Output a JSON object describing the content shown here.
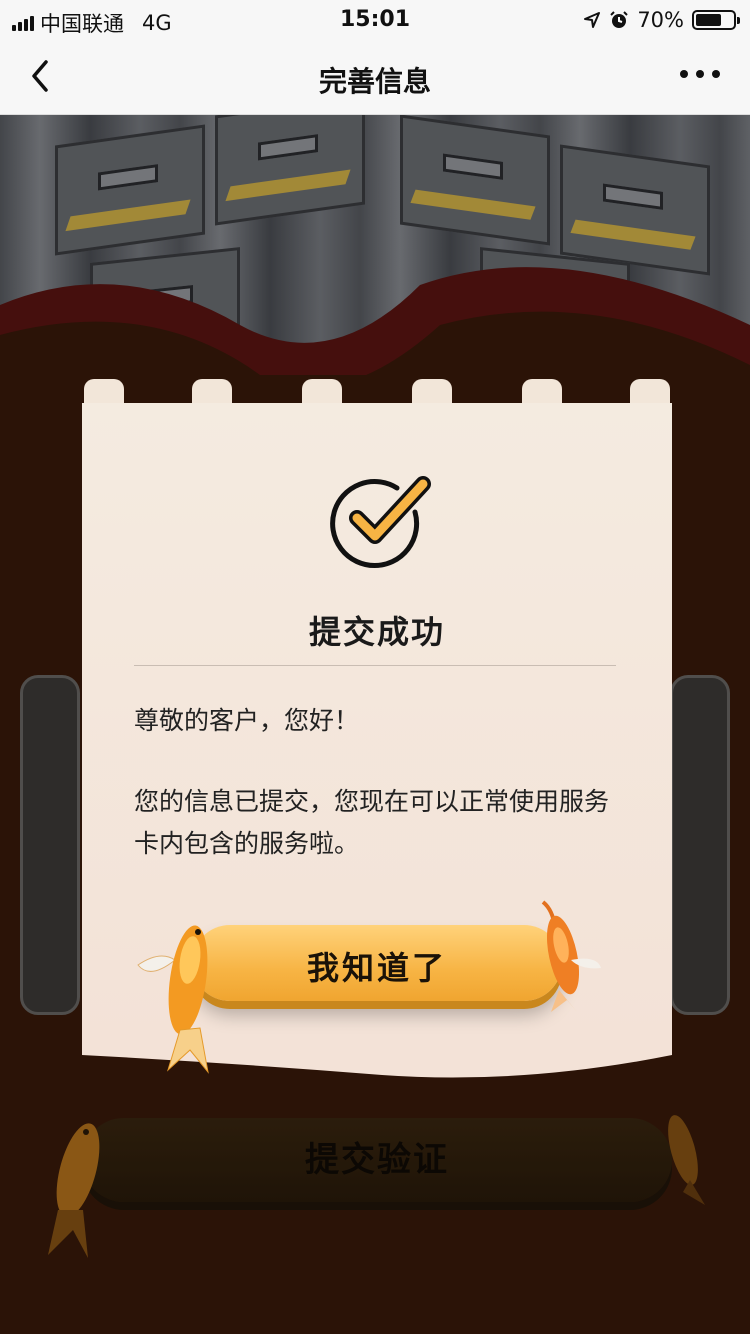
{
  "status_bar": {
    "carrier": "中国联通",
    "network": "4G",
    "time": "15:01",
    "battery_text": "70%",
    "battery_level": 0.7,
    "icons": [
      "signal-icon",
      "location-arrow-icon",
      "alarm-icon",
      "battery-icon"
    ]
  },
  "nav": {
    "title": "完善信息",
    "back_icon": "chevron-left-icon",
    "more_icon": "more-dots-icon"
  },
  "background": {
    "submit_button_label": "提交验证"
  },
  "modal": {
    "icon": "check-circle-icon",
    "title": "提交成功",
    "greeting": "尊敬的客户，您好！",
    "message": "您的信息已提交，您现在可以正常使用服务卡内包含的服务啦。",
    "confirm_label": "我知道了"
  },
  "colors": {
    "accent_orange": "#f7b444",
    "card_bg": "#f4ebe0",
    "background_brown": "#3a1a0a"
  }
}
